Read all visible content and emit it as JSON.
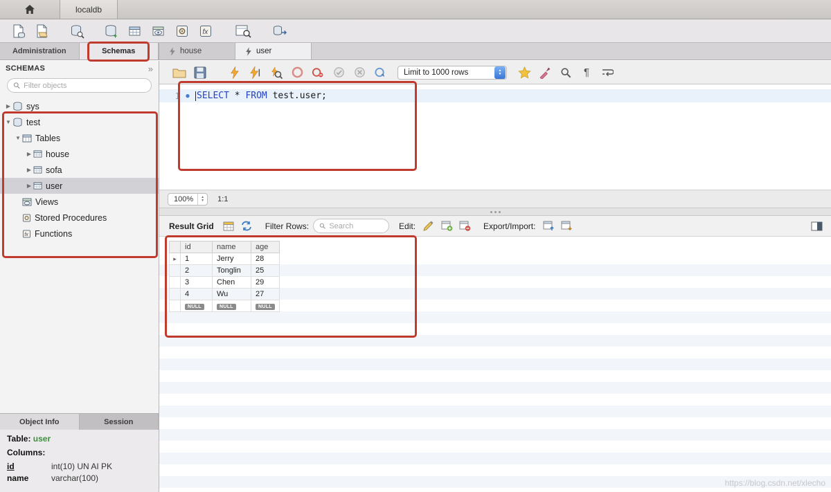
{
  "icons": {
    "home": "⌂",
    "collapse_all": "»",
    "arrow_collapsed": "▶",
    "arrow_expanded": "▼",
    "row_marker": "▸",
    "paragraph": "¶",
    "stepper_up": "▲",
    "stepper_down": "▼"
  },
  "titlebar": {
    "connection_tab": "localdb"
  },
  "sidebar": {
    "tabs": {
      "administration": "Administration",
      "schemas": "Schemas"
    },
    "header": "SCHEMAS",
    "filter_placeholder": "Filter objects",
    "tree": [
      {
        "label": "sys"
      },
      {
        "label": "test"
      },
      {
        "label": "Tables"
      },
      {
        "label": "house"
      },
      {
        "label": "sofa"
      },
      {
        "label": "user"
      },
      {
        "label": "Views"
      },
      {
        "label": "Stored Procedures"
      },
      {
        "label": "Functions"
      }
    ],
    "bottom_tabs": {
      "object_info": "Object Info",
      "session": "Session"
    },
    "object_info": {
      "table_label": "Table:",
      "table_name": "user",
      "columns_label": "Columns:",
      "columns": [
        {
          "name": "id",
          "type": "int(10) UN AI PK"
        },
        {
          "name": "name",
          "type": "varchar(100)"
        }
      ]
    }
  },
  "editor_tabs": {
    "house": "house",
    "user": "user"
  },
  "sql_toolbar": {
    "limit": "Limit to 1000 rows"
  },
  "editor": {
    "line_number": "1",
    "sql": {
      "kw1": "SELECT",
      "star": " * ",
      "kw2": "FROM",
      "rest": " test.user;"
    },
    "zoom": "100%",
    "ratio": "1:1"
  },
  "result": {
    "label": "Result Grid",
    "filter_label": "Filter Rows:",
    "search_placeholder": "Search",
    "edit_label": "Edit:",
    "export_label": "Export/Import:",
    "grid": {
      "headers": [
        "id",
        "name",
        "age"
      ],
      "rows": [
        [
          "1",
          "Jerry",
          "28"
        ],
        [
          "2",
          "Tonglin",
          "25"
        ],
        [
          "3",
          "Chen",
          "29"
        ],
        [
          "4",
          "Wu",
          "27"
        ]
      ],
      "null_label": "NULL"
    }
  },
  "watermark": "https://blog.csdn.net/xlecho"
}
